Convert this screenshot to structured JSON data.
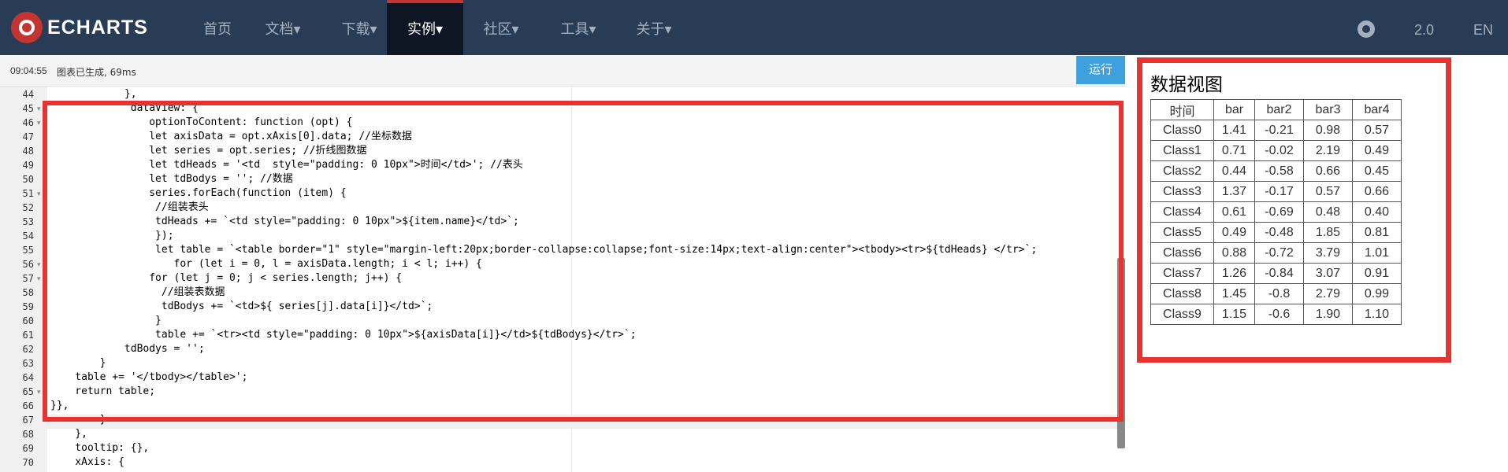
{
  "navbar": {
    "logo_text": "ECHARTS",
    "items": [
      "首页",
      "文档▾",
      "下载▾",
      "实例▾",
      "社区▾",
      "工具▾",
      "关于▾"
    ],
    "version": "2.0",
    "lang": "EN",
    "github_icon": "github-icon"
  },
  "status": {
    "time": "09:04:55",
    "message": "图表已生成, 69ms",
    "run_label": "运行"
  },
  "editor": {
    "line_numbers": [
      "44",
      "45",
      "46",
      "47",
      "48",
      "49",
      "50",
      "51",
      "52",
      "53",
      "54",
      "55",
      "56",
      "57",
      "58",
      "59",
      "60",
      "61",
      "62",
      "63",
      "64",
      "65",
      "66",
      "67",
      "68",
      "69",
      "70"
    ],
    "code_lines": [
      "            },",
      "             dataView: {",
      "                optionToContent: function (opt) {",
      "                let axisData = opt.xAxis[0].data; //坐标数据",
      "                let series = opt.series; //折线图数据",
      "                let tdHeads = '<td  style=\"padding: 0 10px\">时间</td>'; //表头",
      "                let tdBodys = ''; //数据",
      "                series.forEach(function (item) {",
      "                 //组装表头",
      "                 tdHeads += `<td style=\"padding: 0 10px\">${item.name}</td>`;",
      "                 });",
      "                 let table = `<table border=\"1\" style=\"margin-left:20px;border-collapse:collapse;font-size:14px;text-align:center\"><tbody><tr>${tdHeads} </tr>`;",
      "                    for (let i = 0, l = axisData.length; i < l; i++) {",
      "                for (let j = 0; j < series.length; j++) {",
      "                  //组装表数据",
      "                  tdBodys += `<td>${ series[j].data[i]}</td>`;",
      "                 }",
      "                 table += `<tr><td style=\"padding: 0 10px\">${axisData[i]}</td>${tdBodys}</tr>`;",
      "            tdBodys = '';",
      "        }",
      "    table += '</tbody></table>';",
      "    return table;",
      "}},",
      "        }",
      "    },",
      "    tooltip: {},",
      "    xAxis: {"
    ]
  },
  "data_view": {
    "title": "数据视图",
    "headers": [
      "时间",
      "bar",
      "bar2",
      "bar3",
      "bar4"
    ],
    "rows": [
      [
        "Class0",
        "1.41",
        "-0.21",
        "0.98",
        "0.57"
      ],
      [
        "Class1",
        "0.71",
        "-0.02",
        "2.19",
        "0.49"
      ],
      [
        "Class2",
        "0.44",
        "-0.58",
        "0.66",
        "0.45"
      ],
      [
        "Class3",
        "1.37",
        "-0.17",
        "0.57",
        "0.66"
      ],
      [
        "Class4",
        "0.61",
        "-0.69",
        "0.48",
        "0.40"
      ],
      [
        "Class5",
        "0.49",
        "-0.48",
        "1.85",
        "0.81"
      ],
      [
        "Class6",
        "0.88",
        "-0.72",
        "3.79",
        "1.01"
      ],
      [
        "Class7",
        "1.26",
        "-0.84",
        "3.07",
        "0.91"
      ],
      [
        "Class8",
        "1.45",
        "-0.8",
        "2.79",
        "0.99"
      ],
      [
        "Class9",
        "1.15",
        "-0.6",
        "1.90",
        "1.10"
      ]
    ]
  },
  "colors": {
    "navbar_bg": "#293c55",
    "accent_red": "#e8322f",
    "run_button": "#3fa0de"
  }
}
